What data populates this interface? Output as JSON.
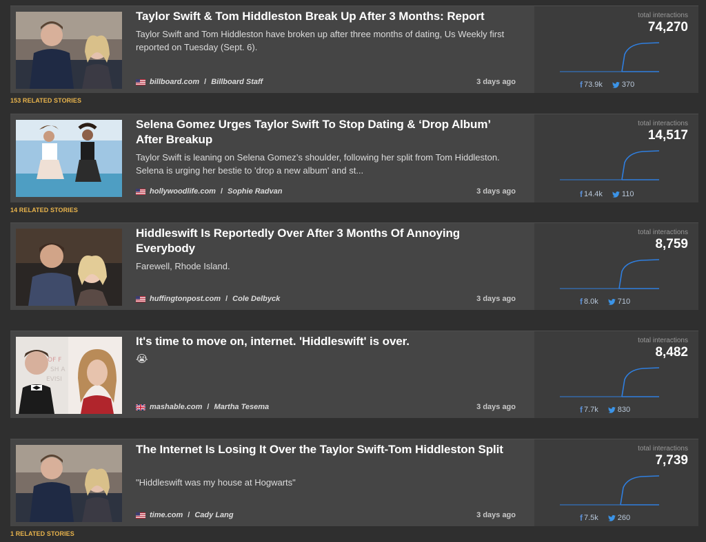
{
  "colors": {
    "accent": "#2f7fe0",
    "related": "#e9b44c",
    "background": "#2f2f2f",
    "card": "#454545"
  },
  "stories": [
    {
      "title": "Taylor Swift & Tom Hiddleston Break Up After 3 Months: Report",
      "description": "Taylor Swift and Tom Hiddleston have broken up after three months of dating, Us Weekly first reported on Tuesday (Sept. 6).",
      "flag": "us-flag",
      "domain": "billboard.com",
      "author": "Billboard Staff",
      "age": "3 days ago",
      "interactions_label": "total interactions",
      "interactions": "74,270",
      "facebook": "73.9k",
      "twitter": "370"
    },
    {
      "title": "Selena Gomez Urges Taylor Swift To Stop Dating & ‘Drop Album’ After Breakup",
      "description": "Taylor Swift is leaning on Selena Gomez’s shoulder, following her split from Tom Hiddleston. Selena is urging her bestie to 'drop a new album' and st...",
      "flag": "us-flag",
      "domain": "hollywoodlife.com",
      "author": "Sophie Radvan",
      "age": "3 days ago",
      "interactions_label": "total interactions",
      "interactions": "14,517",
      "facebook": "14.4k",
      "twitter": "110"
    },
    {
      "title": "Hiddleswift Is Reportedly Over After 3 Months Of Annoying Everybody",
      "description": "Farewell, Rhode Island.",
      "flag": "us-flag",
      "domain": "huffingtonpost.com",
      "author": "Cole Delbyck",
      "age": "3 days ago",
      "interactions_label": "total interactions",
      "interactions": "8,759",
      "facebook": "8.0k",
      "twitter": "710"
    },
    {
      "title": "It's time to move on, internet. 'Hiddleswift' is over.",
      "description": "😭",
      "flag": "uk-flag",
      "domain": "mashable.com",
      "author": "Martha Tesema",
      "age": "3 days ago",
      "interactions_label": "total interactions",
      "interactions": "8,482",
      "facebook": "7.7k",
      "twitter": "830"
    },
    {
      "title": "The Internet Is Losing It Over the Taylor Swift-Tom Hiddleston Split",
      "description": "\"Hiddleswift was my house at Hogwarts\"",
      "flag": "us-flag",
      "domain": "time.com",
      "author": "Cady Lang",
      "age": "3 days ago",
      "interactions_label": "total interactions",
      "interactions": "7,739",
      "facebook": "7.5k",
      "twitter": "260"
    }
  ],
  "related": [
    "153 RELATED STORIES",
    "14 RELATED STORIES",
    "1 RELATED STORIES"
  ]
}
